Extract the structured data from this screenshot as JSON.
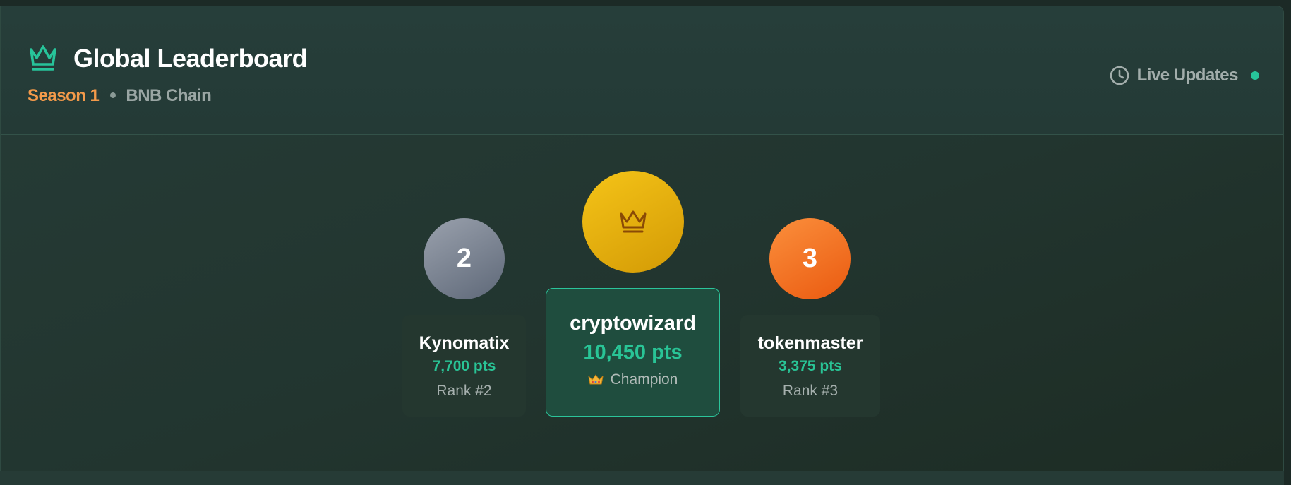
{
  "header": {
    "title": "Global Leaderboard",
    "season": "Season 1",
    "chain": "BNB Chain",
    "live_label": "Live Updates"
  },
  "podium": {
    "second": {
      "badge": "2",
      "name": "Kynomatix",
      "points": "7,700 pts",
      "rank": "Rank #2"
    },
    "first": {
      "badge_icon": "crown-icon",
      "name": "cryptowizard",
      "points": "10,450 pts",
      "title": "Champion"
    },
    "third": {
      "badge": "3",
      "name": "tokenmaster",
      "points": "3,375 pts",
      "rank": "Rank #3"
    }
  },
  "colors": {
    "accent": "#27c49a",
    "season": "#f39a4a",
    "gold": "#f5c418",
    "silver": "#7d8594",
    "bronze": "#f26f22"
  },
  "icons": [
    "crown-icon",
    "clock-icon",
    "live-indicator-dot"
  ]
}
